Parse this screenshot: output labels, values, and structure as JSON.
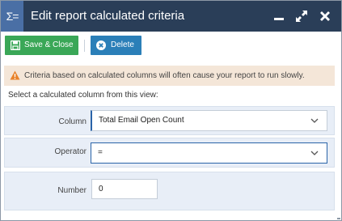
{
  "window": {
    "title": "Edit report calculated criteria",
    "app_icon": "Σ="
  },
  "toolbar": {
    "save_label": "Save & Close",
    "delete_label": "Delete"
  },
  "warning": {
    "text": "Criteria based on calculated columns will often cause your report to run slowly."
  },
  "instruction": "Select a calculated column from this view:",
  "form": {
    "column": {
      "label": "Column",
      "value": "Total Email Open Count"
    },
    "operator": {
      "label": "Operator",
      "value": "="
    },
    "number": {
      "label": "Number",
      "value": "0"
    }
  },
  "colors": {
    "titlebar": "#2a3e58",
    "save_button": "#3aa757",
    "delete_button": "#2b7fb8",
    "warning_bg": "#f4e6d8",
    "warning_icon": "#e8822a",
    "row_bg": "#e8eef7"
  }
}
